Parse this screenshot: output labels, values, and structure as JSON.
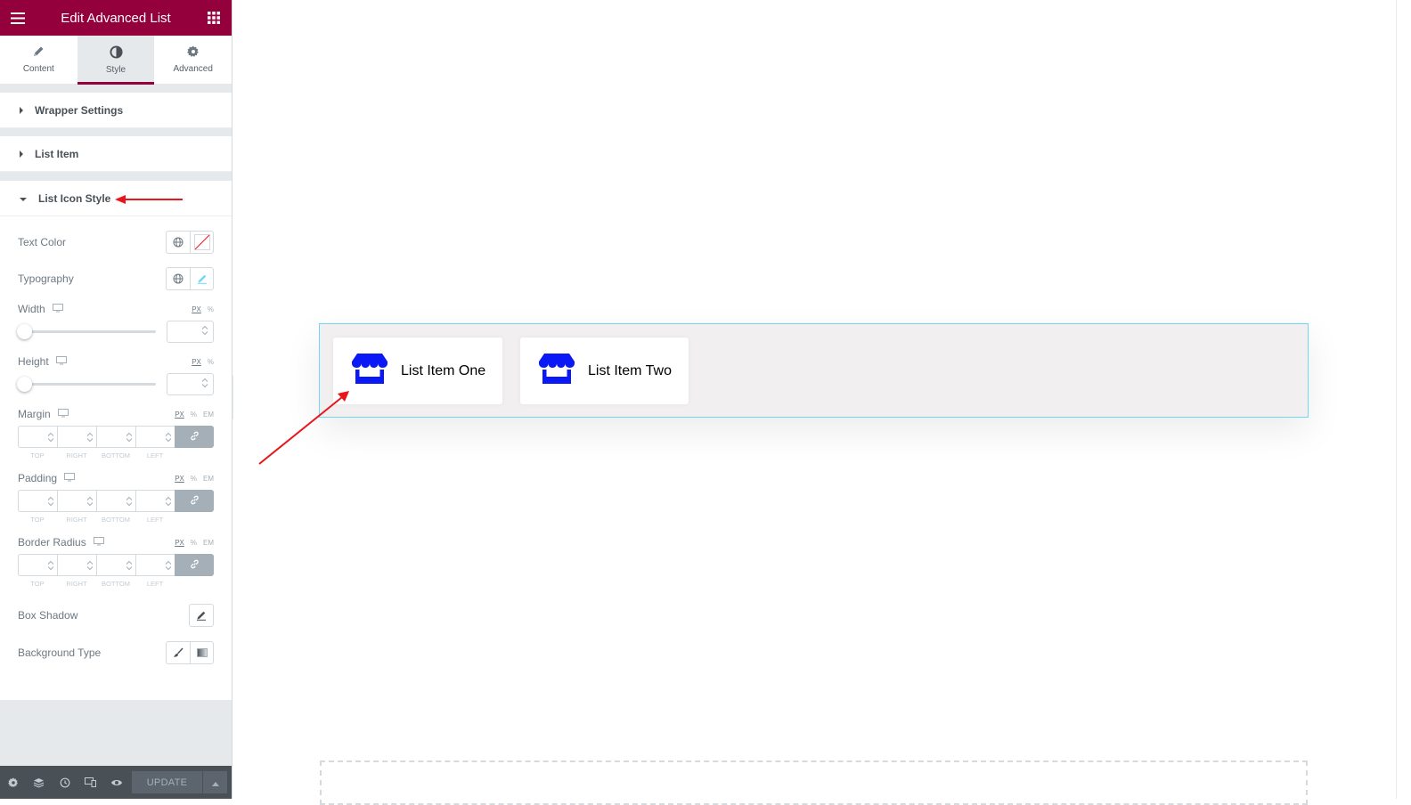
{
  "header": {
    "title": "Edit Advanced List",
    "menu_icon": "hamburger-icon",
    "grid_icon": "apps-grid-icon"
  },
  "tabs": [
    {
      "label": "Content",
      "icon": "pencil-icon"
    },
    {
      "label": "Style",
      "icon": "contrast-icon",
      "active": true
    },
    {
      "label": "Advanced",
      "icon": "gear-icon"
    }
  ],
  "sections": {
    "wrapper": "Wrapper Settings",
    "list_item": "List Item",
    "list_icon_style": "List Icon Style"
  },
  "controls": {
    "text_color": "Text Color",
    "typography": "Typography",
    "width": {
      "label": "Width",
      "units": [
        "PX",
        "%"
      ],
      "value": 0
    },
    "height": {
      "label": "Height",
      "units": [
        "PX",
        "%"
      ],
      "value": 0
    },
    "margin": {
      "label": "Margin",
      "units": [
        "PX",
        "%",
        "EM"
      ]
    },
    "padding": {
      "label": "Padding",
      "units": [
        "PX",
        "%",
        "EM"
      ]
    },
    "border_radius": {
      "label": "Border Radius",
      "units": [
        "PX",
        "%",
        "EM"
      ]
    },
    "dim_labels": [
      "TOP",
      "RIGHT",
      "BOTTOM",
      "LEFT"
    ],
    "box_shadow": "Box Shadow",
    "background_type": "Background Type"
  },
  "footer": {
    "update_label": "UPDATE"
  },
  "canvas": {
    "items": [
      {
        "label": "List Item One",
        "icon": "store-icon"
      },
      {
        "label": "List Item Two",
        "icon": "store-icon"
      }
    ],
    "icon_color": "#0a19f5",
    "annotation_color": "#e8161b"
  },
  "colors": {
    "brand": "#93003c",
    "accent_border": "#71d7f7"
  }
}
